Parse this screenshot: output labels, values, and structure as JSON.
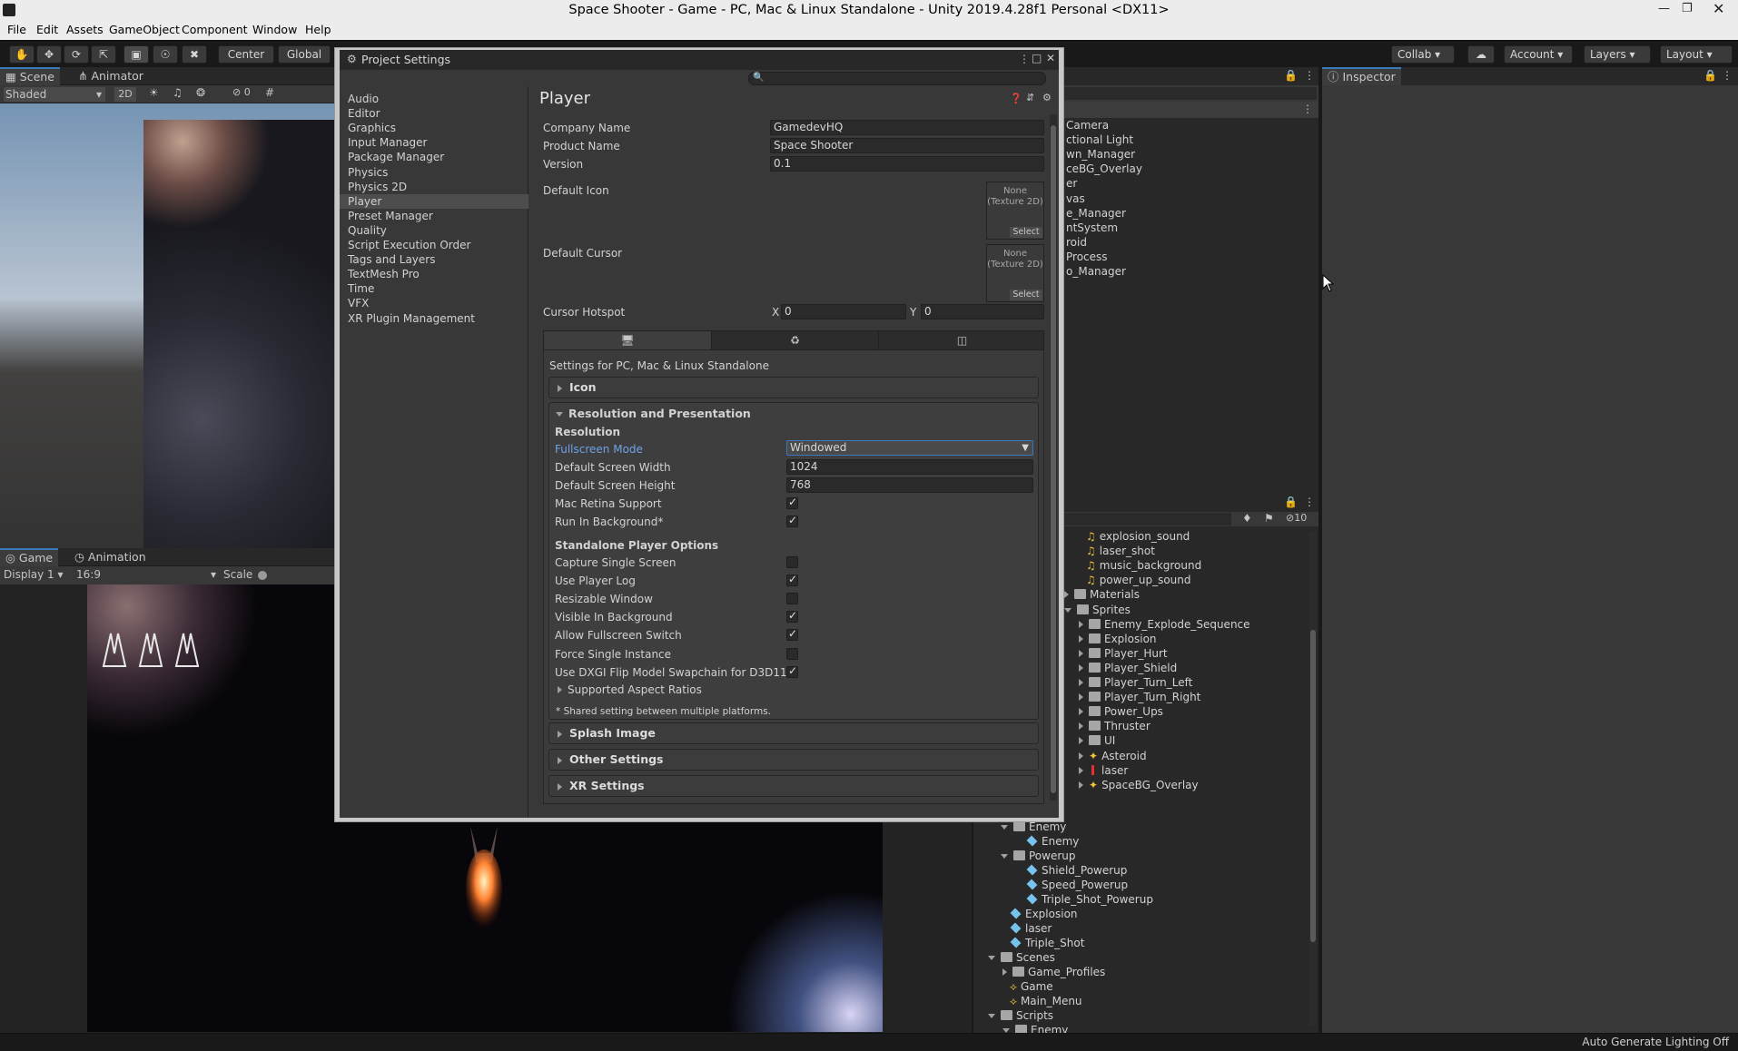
{
  "window": {
    "title": "Space Shooter - Game - PC, Mac & Linux Standalone - Unity 2019.4.28f1 Personal <DX11>"
  },
  "menu": [
    "File",
    "Edit",
    "Assets",
    "GameObject",
    "Component",
    "Window",
    "Help"
  ],
  "toolbar": {
    "center": "Center",
    "global": "Global",
    "collab": "Collab",
    "account": "Account",
    "layers": "Layers",
    "layout": "Layout"
  },
  "scene": {
    "tab_scene": "Scene",
    "tab_animator": "Animator",
    "shading": "Shaded",
    "mode_2d": "2D",
    "gizmo_count": "0"
  },
  "game": {
    "tab_game": "Game",
    "tab_animation": "Animation",
    "display": "Display 1",
    "aspect": "16:9",
    "scale": "Scale"
  },
  "inspector": {
    "tab": "Inspector"
  },
  "hierarchy_top": [
    "Camera",
    "ctional Light",
    "wn_Manager",
    "ceBG_Overlay",
    "er",
    "vas",
    "e_Manager",
    "ntSystem",
    "roid",
    "Process",
    "o_Manager"
  ],
  "project": {
    "hidden_count": "10",
    "audio": [
      "explosion_sound",
      "laser_shot",
      "music_background",
      "power_up_sound"
    ],
    "materials": "Materials",
    "sprites": "Sprites",
    "sprite_children": [
      "Enemy_Explode_Sequence",
      "Explosion",
      "Player_Hurt",
      "Player_Shield",
      "Player_Turn_Left",
      "Player_Turn_Right",
      "Power_Ups",
      "Thruster",
      "UI",
      "Asteroid",
      "laser",
      "SpaceBG_Overlay"
    ],
    "enemy_folder": "Enemy",
    "enemy_prefab": "Enemy",
    "powerup_folder": "Powerup",
    "powerups": [
      "Shield_Powerup",
      "Speed_Powerup",
      "Triple_Shot_Powerup"
    ],
    "prefabs": [
      "Explosion",
      "laser",
      "Triple_Shot"
    ],
    "scenes_folder": "Scenes",
    "game_profiles": "Game_Profiles",
    "scenes": [
      "Game",
      "Main_Menu"
    ],
    "scripts_folder": "Scripts",
    "scripts_enemy": "Enemy"
  },
  "status": {
    "lighting": "Auto Generate Lighting Off"
  },
  "project_settings": {
    "title": "Project Settings",
    "categories": [
      "Audio",
      "Editor",
      "Graphics",
      "Input Manager",
      "Package Manager",
      "Physics",
      "Physics 2D",
      "Player",
      "Preset Manager",
      "Quality",
      "Script Execution Order",
      "Tags and Layers",
      "TextMesh Pro",
      "Time",
      "VFX",
      "XR Plugin Management"
    ],
    "selected_category": "Player",
    "heading": "Player",
    "company_name_label": "Company Name",
    "company_name": "GamedevHQ",
    "product_name_label": "Product Name",
    "product_name": "Space Shooter",
    "version_label": "Version",
    "version": "0.1",
    "default_icon_label": "Default Icon",
    "default_cursor_label": "Default Cursor",
    "texture_none": "None",
    "texture_type": "(Texture 2D)",
    "select": "Select",
    "cursor_hotspot_label": "Cursor Hotspot",
    "hotspot_x_label": "X",
    "hotspot_x": "0",
    "hotspot_y_label": "Y",
    "hotspot_y": "0",
    "platform_settings_label": "Settings for PC, Mac & Linux Standalone",
    "icon_section": "Icon",
    "resolution_section": "Resolution and Presentation",
    "resolution_header": "Resolution",
    "fullscreen_mode_label": "Fullscreen Mode",
    "fullscreen_mode": "Windowed",
    "screen_width_label": "Default Screen Width",
    "screen_width": "1024",
    "screen_height_label": "Default Screen Height",
    "screen_height": "768",
    "mac_retina_label": "Mac Retina Support",
    "run_in_background_label": "Run In Background*",
    "standalone_header": "Standalone Player Options",
    "standalone_options": [
      {
        "label": "Capture Single Screen",
        "checked": false
      },
      {
        "label": "Use Player Log",
        "checked": true
      },
      {
        "label": "Resizable Window",
        "checked": false
      },
      {
        "label": "Visible In Background",
        "checked": true
      },
      {
        "label": "Allow Fullscreen Switch",
        "checked": true
      },
      {
        "label": "Force Single Instance",
        "checked": false
      },
      {
        "label": "Use DXGI Flip Model Swapchain for D3D11",
        "checked": true
      }
    ],
    "supported_aspect_ratios": "Supported Aspect Ratios",
    "shared_note": "* Shared setting between multiple platforms.",
    "splash_section": "Splash Image",
    "other_section": "Other Settings",
    "xr_section": "XR Settings"
  },
  "colors": {
    "accent": "#3a79bb",
    "link": "#6ea3e6",
    "bg": "#383838"
  }
}
